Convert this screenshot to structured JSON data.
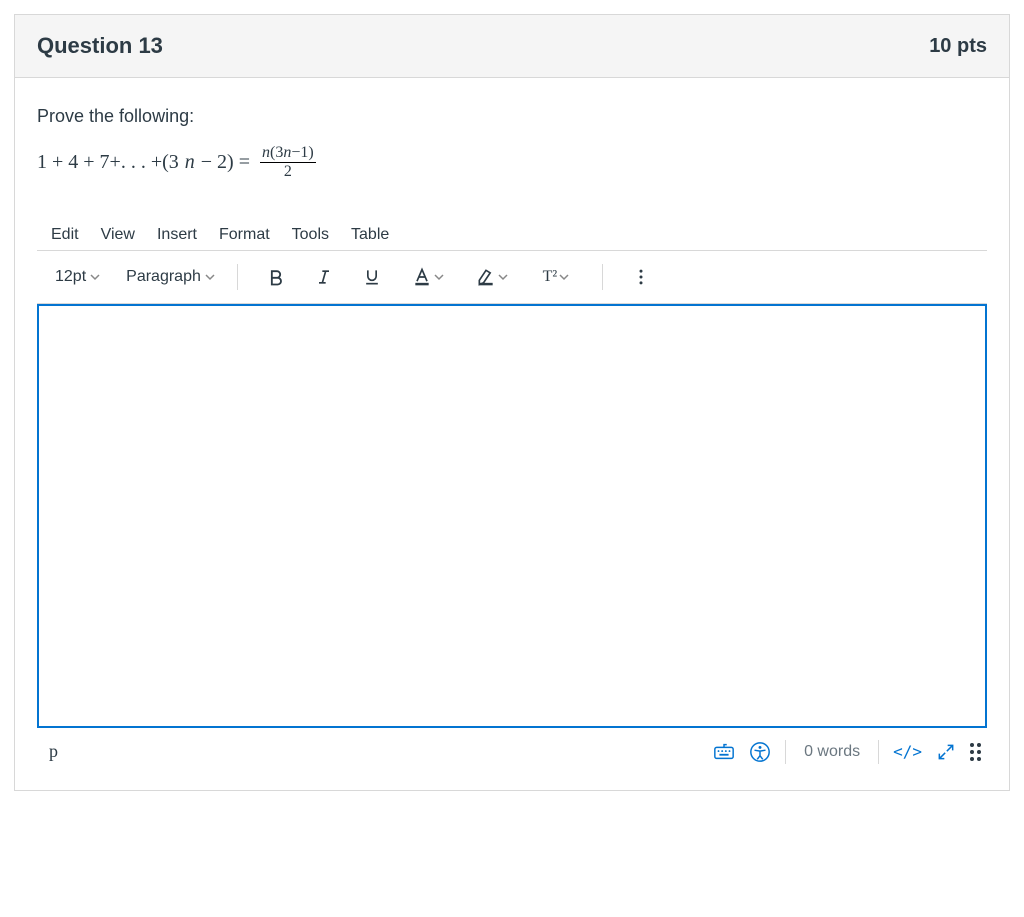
{
  "header": {
    "title": "Question 13",
    "points": "10 pts"
  },
  "prompt": {
    "lead": "Prove the following:"
  },
  "equation": {
    "lhs_prefix": "1 + 4 + 7+. . . +(3",
    "n1": "n",
    "lhs_suffix": " − 2) = ",
    "num_left": "n",
    "num_mid": "(3",
    "num_n": "n",
    "num_right": "−1)",
    "den": "2"
  },
  "menubar": [
    "Edit",
    "View",
    "Insert",
    "Format",
    "Tools",
    "Table"
  ],
  "toolbar": {
    "font_size": "12pt",
    "block": "Paragraph",
    "superscript_label": "T²"
  },
  "status": {
    "path": "p",
    "word_count": "0 words",
    "html_label": "</>"
  }
}
